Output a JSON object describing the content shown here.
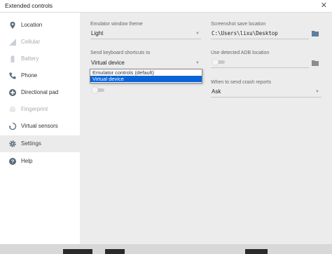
{
  "window": {
    "title": "Extended controls",
    "close_glyph": "✕"
  },
  "sidebar": {
    "items": [
      {
        "label": "Location",
        "icon": "location-pin-icon",
        "enabled": true
      },
      {
        "label": "Cellular",
        "icon": "cellular-signal-icon",
        "enabled": false
      },
      {
        "label": "Battery",
        "icon": "battery-icon",
        "enabled": false
      },
      {
        "label": "Phone",
        "icon": "phone-icon",
        "enabled": true
      },
      {
        "label": "Directional pad",
        "icon": "dpad-icon",
        "enabled": true
      },
      {
        "label": "Fingerprint",
        "icon": "fingerprint-icon",
        "enabled": false
      },
      {
        "label": "Virtual sensors",
        "icon": "rotate-icon",
        "enabled": true
      },
      {
        "label": "Settings",
        "icon": "gear-icon",
        "enabled": true,
        "active": true
      },
      {
        "label": "Help",
        "icon": "help-icon",
        "enabled": true
      }
    ]
  },
  "settings": {
    "theme": {
      "label": "Emulator window theme",
      "value": "Light"
    },
    "screenshot": {
      "label": "Screenshot save location",
      "value": "C:\\Users\\lixu\\Desktop"
    },
    "shortcuts": {
      "label": "Send keyboard shortcuts to",
      "value": "Virtual device",
      "options": [
        "Emulator controls (default)",
        "Virtual device"
      ],
      "selected_index": 1
    },
    "adb": {
      "label": "Use detected ADB location",
      "enabled": false
    },
    "crash": {
      "label": "When to send crash reports",
      "value": "Ask"
    },
    "left_toggle": {
      "enabled": false
    }
  },
  "colors": {
    "selection": "#0a64d8",
    "accent": "#5f7f9e"
  }
}
